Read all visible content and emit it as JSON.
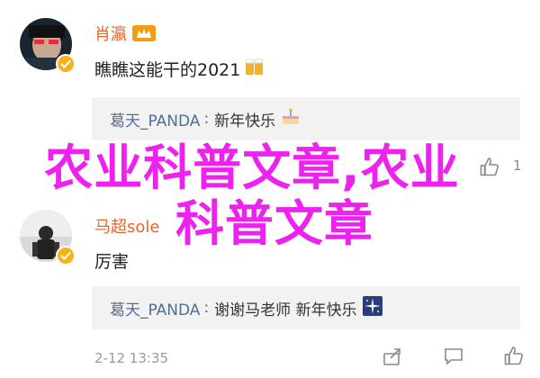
{
  "comments": [
    {
      "username": "肖瀛",
      "text": "瞧瞧这能干的2021",
      "emoji_icon": "beer-icon",
      "reply": {
        "author": "葛天_PANDA",
        "separator": ":",
        "text": "新年快乐",
        "emoji_icon": "cake-icon"
      },
      "like_count": "1"
    },
    {
      "username": "马超sole",
      "text": "厉害",
      "reply": {
        "author": "葛天_PANDA",
        "separator": ":",
        "text": "谢谢马老师 新年快乐",
        "emoji_icon": "sparkle-icon"
      },
      "timestamp": "2-12 13:35"
    }
  ],
  "watermark": {
    "line1": "农业科普文章,农业",
    "line2": "科普文章"
  },
  "colors": {
    "username": "#e8652c",
    "reply_author": "#4f6f94",
    "watermark": "#ee22ee",
    "reply_bg": "#f2f2f2",
    "verify_badge": "#f6b21c"
  }
}
